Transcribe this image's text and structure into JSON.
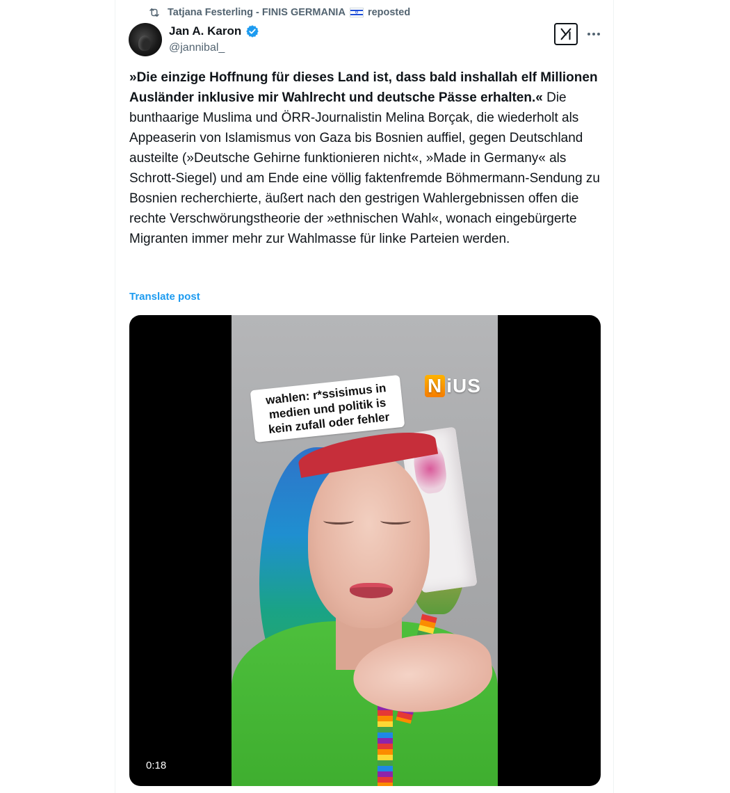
{
  "repost": {
    "text": "Tatjana Festerling - FINIS GERMANIA",
    "suffix": "reposted"
  },
  "author": {
    "name": "Jan A. Karon",
    "handle": "@jannibal_",
    "verified": true
  },
  "post": {
    "bold_quote": "»Die einzige Hoffnung für dieses Land ist, dass bald inshallah elf Millionen Ausländer inklusive mir Wahlrecht und deutsche Pässe erhalten.«",
    "body": " Die bunthaarige Muslima und ÖRR-Journalistin Melina Borçak, die wiederholt als Appeaserin von Islamismus von Gaza bis Bosnien auffiel, gegen Deutschland austeilte (»Deutsche Gehirne funktionieren nicht«, »Made in Germany« als Schrott-Siegel) und am Ende eine völlig faktenfremde Böhmermann-Sendung zu Bosnien recherchierte, äußert nach den gestrigen Wahlergebnissen offen die rechte Verschwörungstheorie der »ethnischen Wahl«, wonach eingebürgerte Migranten immer mehr zur Wahlmasse für linke Parteien werden.",
    "translate_label": "Translate post"
  },
  "media": {
    "caption": "wahlen: r*ssisimus in medien und politik is kein zufall oder fehler",
    "logo_n": "N",
    "logo_rest": "iUS",
    "duration": "0:18"
  },
  "colors": {
    "accent": "#1d9bf0",
    "text": "#0f1419",
    "muted": "#536471"
  },
  "icons": [
    "repost-icon",
    "verified-badge-icon",
    "grok-icon",
    "more-icon",
    "israel-flag-icon"
  ]
}
